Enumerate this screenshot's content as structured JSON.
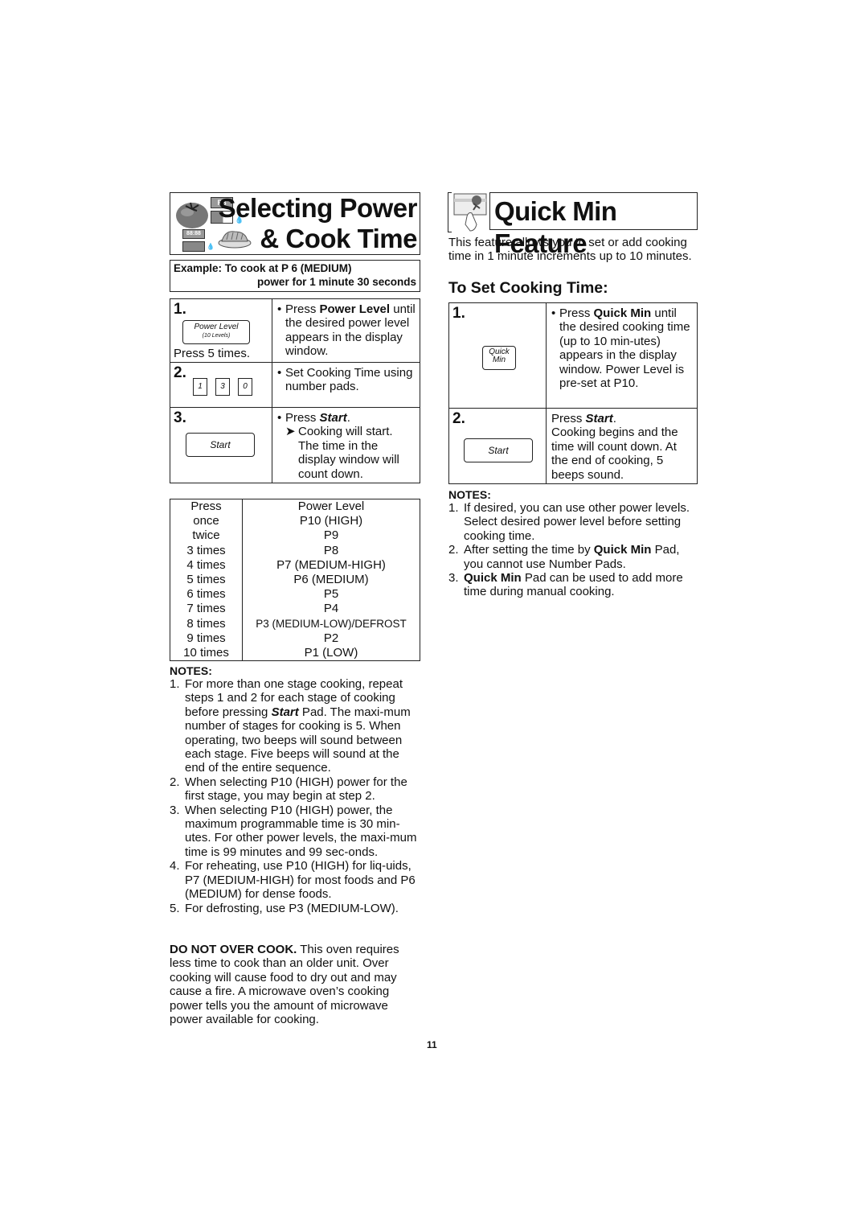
{
  "left": {
    "title_line1": "Selecting Power",
    "title_line2": "& Cook Time",
    "icon_display_top": "P8",
    "icon_display_bottom": "88:88",
    "example_line1": "Example: To cook at P 6 (MEDIUM)",
    "example_line2": "power for 1 minute 30 seconds",
    "steps": [
      {
        "num": "1.",
        "pad_label": "Power Level",
        "pad_sublabel": "(10 Levels)",
        "caption": "Press 5 times.",
        "bullet": "•",
        "text_pre": "Press ",
        "text_bold": "Power Level",
        "text_post": " until the desired power level appears in the display window."
      },
      {
        "num": "2.",
        "number_pads": [
          "1",
          "3",
          "0"
        ],
        "bullet": "•",
        "text": "Set Cooking Time using number pads."
      },
      {
        "num": "3.",
        "pad_label": "Start",
        "bullet": "•",
        "text_pre": "Press ",
        "text_bold": "Start",
        "text_post": ".",
        "arrow": "➤",
        "sub_text": "Cooking will start. The time in the display window will count down."
      }
    ],
    "power_table": {
      "headers": [
        "Press",
        "Power Level"
      ],
      "rows": [
        [
          "once",
          "P10 (HIGH)"
        ],
        [
          "twice",
          "P9"
        ],
        [
          "3 times",
          "P8"
        ],
        [
          "4 times",
          "P7 (MEDIUM-HIGH)"
        ],
        [
          "5 times",
          "P6 (MEDIUM)"
        ],
        [
          "6 times",
          "P5"
        ],
        [
          "7 times",
          "P4"
        ],
        [
          "8 times",
          "P3 (MEDIUM-LOW)/DEFROST"
        ],
        [
          "9 times",
          "P2"
        ],
        [
          "10 times",
          "P1 (LOW)"
        ]
      ]
    },
    "notes_heading": "NOTES:",
    "notes": [
      {
        "num": "1.",
        "pre": "For more than one stage cooking, repeat steps 1 and 2 for each stage of cooking before pressing ",
        "bold": "Start",
        "post": " Pad. The maxi-mum number of stages for cooking is 5. When operating, two beeps will sound between each stage. Five beeps will sound at the end of the entire sequence."
      },
      {
        "num": "2.",
        "pre": "When selecting P10 (HIGH) power for the first stage, you may begin at step 2.",
        "bold": "",
        "post": ""
      },
      {
        "num": "3.",
        "pre": "When selecting P10 (HIGH) power, the maximum programmable time is 30 min-utes. For other power levels, the maxi-mum time is 99 minutes and 99 sec-onds.",
        "bold": "",
        "post": ""
      },
      {
        "num": "4.",
        "pre": "For reheating, use P10 (HIGH) for liq-uids, P7 (MEDIUM-HIGH) for most foods and P6 (MEDIUM) for dense foods.",
        "bold": "",
        "post": ""
      },
      {
        "num": "5.",
        "pre": "For defrosting, use P3 (MEDIUM-LOW).",
        "bold": "",
        "post": ""
      }
    ],
    "warning_bold": "DO NOT OVER COOK.",
    "warning_text": " This oven requires less time to cook than an older unit. Over cooking will cause food to dry out and may cause a fire. A microwave oven’s cooking power tells you the amount of microwave power available for cooking."
  },
  "right": {
    "title": "Quick Min Feature",
    "intro": "This feature allows you to set or add cooking time in 1 minute increments up to 10 minutes.",
    "subheading": "To Set Cooking Time:",
    "steps": [
      {
        "num": "1.",
        "pad_label_line1": "Quick",
        "pad_label_line2": "Min",
        "bullet": "•",
        "text_pre": "Press ",
        "text_bold": "Quick Min",
        "text_post": " until the desired cooking time (up to 10 min-utes) appears in the display window. Power Level is pre-set at P10."
      },
      {
        "num": "2.",
        "pad_label": "Start",
        "text_pre": "Press ",
        "text_bold": "Start",
        "text_post": ".",
        "sub_text": "Cooking begins and the time will count down. At the end of cooking, 5 beeps sound."
      }
    ],
    "notes_heading": "NOTES:",
    "notes": [
      {
        "num": "1.",
        "pre": "If desired, you can use other power levels. Select desired power level before setting cooking time.",
        "bold": "",
        "post": ""
      },
      {
        "num": "2.",
        "pre": "After setting the time by ",
        "bold": "Quick Min",
        "post": " Pad, you cannot use Number Pads."
      },
      {
        "num": "3.",
        "pre": "",
        "bold": "Quick Min",
        "post": " Pad can be used to add more time during manual cooking."
      }
    ]
  },
  "page_number": "11"
}
